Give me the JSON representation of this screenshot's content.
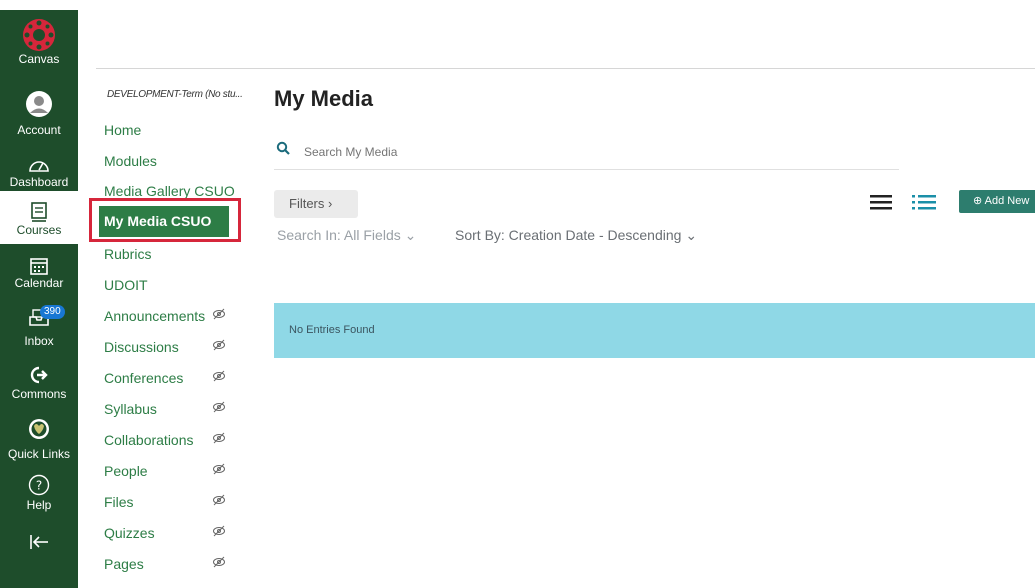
{
  "global_nav": {
    "items": [
      {
        "label": "Canvas",
        "icon": "canvas-logo-icon"
      },
      {
        "label": "Account",
        "icon": "avatar-icon"
      },
      {
        "label": "Dashboard",
        "icon": "dashboard-icon"
      },
      {
        "label": "Courses",
        "icon": "courses-icon"
      },
      {
        "label": "Calendar",
        "icon": "calendar-icon"
      },
      {
        "label": "Inbox",
        "icon": "inbox-icon",
        "badge": "390"
      },
      {
        "label": "Commons",
        "icon": "commons-icon"
      },
      {
        "label": "Quick Links",
        "icon": "ram-logo-icon"
      },
      {
        "label": "Help",
        "icon": "help-icon"
      }
    ],
    "collapse_icon": "collapse-nav-icon"
  },
  "course_nav": {
    "term": "DEVELOPMENT-Term (No stu...",
    "items": [
      {
        "label": "Home",
        "hidden": false
      },
      {
        "label": "Modules",
        "hidden": false
      },
      {
        "label": "Media Gallery CSUO",
        "hidden": false
      },
      {
        "label": "My Media CSUO",
        "hidden": false,
        "active": true
      },
      {
        "label": "Rubrics",
        "hidden": false
      },
      {
        "label": "UDOIT",
        "hidden": false
      },
      {
        "label": "Announcements",
        "hidden": true
      },
      {
        "label": "Discussions",
        "hidden": true
      },
      {
        "label": "Conferences",
        "hidden": true
      },
      {
        "label": "Syllabus",
        "hidden": true
      },
      {
        "label": "Collaborations",
        "hidden": true
      },
      {
        "label": "People",
        "hidden": true
      },
      {
        "label": "Files",
        "hidden": true
      },
      {
        "label": "Quizzes",
        "hidden": true
      },
      {
        "label": "Pages",
        "hidden": true
      }
    ]
  },
  "main": {
    "title": "My Media",
    "search_placeholder": "Search My Media",
    "filters_label": "Filters ›",
    "search_in": "Search In: All Fields ⌄",
    "sort_by": "Sort By: Creation Date - Descending ⌄",
    "add_new_label": "⊕ Add New",
    "no_entries": "No Entries Found"
  },
  "colors": {
    "nav_bg": "#1e4d2b",
    "link_green": "#2d7d46",
    "highlight_red": "#d6263b",
    "info_bg": "#8fd8e6",
    "add_button": "#2d7d6e"
  }
}
